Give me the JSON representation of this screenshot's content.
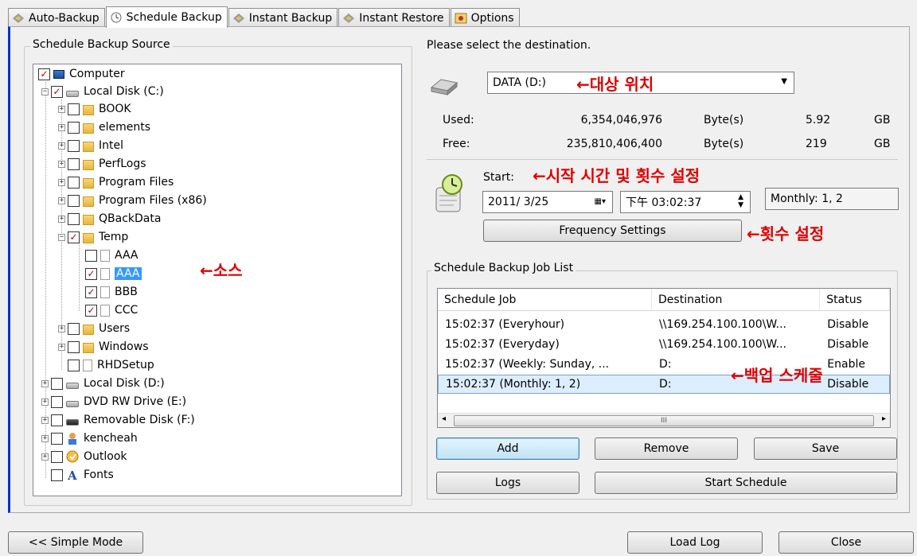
{
  "tabs": [
    {
      "label": "Auto-Backup"
    },
    {
      "label": "Schedule Backup"
    },
    {
      "label": "Instant Backup"
    },
    {
      "label": "Instant Restore"
    },
    {
      "label": "Options"
    }
  ],
  "source": {
    "group_label": "Schedule Backup Source",
    "tree": [
      {
        "label": "Computer"
      },
      {
        "label": "Local Disk (C:)"
      },
      {
        "label": "BOOK"
      },
      {
        "label": "elements"
      },
      {
        "label": "Intel"
      },
      {
        "label": "PerfLogs"
      },
      {
        "label": "Program Files"
      },
      {
        "label": "Program Files (x86)"
      },
      {
        "label": "QBackData"
      },
      {
        "label": "Temp"
      },
      {
        "label": "AAA"
      },
      {
        "label": "AAA"
      },
      {
        "label": "BBB"
      },
      {
        "label": "CCC"
      },
      {
        "label": "Users"
      },
      {
        "label": "Windows"
      },
      {
        "label": "RHDSetup"
      },
      {
        "label": "Local Disk (D:)"
      },
      {
        "label": "DVD RW Drive (E:)"
      },
      {
        "label": "Removable Disk (F:)"
      },
      {
        "label": "kencheah"
      },
      {
        "label": "Outlook"
      },
      {
        "label": "Fonts"
      }
    ]
  },
  "destination": {
    "prompt": "Please select the destination.",
    "selected": "DATA (D:)",
    "used_label": "Used:",
    "used_bytes": "6,354,046,976",
    "used_unit": "Byte(s)",
    "used_gb": "5.92",
    "free_label": "Free:",
    "free_bytes": "235,810,406,400",
    "free_unit": "Byte(s)",
    "free_gb": "219",
    "gb": "GB"
  },
  "schedule": {
    "start_label": "Start:",
    "date": "2011/ 3/25",
    "time": "下午 03:02:37",
    "summary": "Monthly: 1, 2",
    "frequency_button": "Frequency Settings"
  },
  "joblist": {
    "group_label": "Schedule Backup Job List",
    "columns": [
      "Schedule Job",
      "Destination",
      "Status"
    ],
    "rows": [
      {
        "job": "15:02:37 (Everyhour)",
        "dest": "\\\\169.254.100.100\\W...",
        "status": "Disable"
      },
      {
        "job": "15:02:37 (Everyday)",
        "dest": "\\\\169.254.100.100\\W...",
        "status": "Disable"
      },
      {
        "job": "15:02:37 (Weekly: Sunday, ...",
        "dest": "D:",
        "status": "Enable"
      },
      {
        "job": "15:02:37 (Monthly: 1, 2)",
        "dest": "D:",
        "status": "Disable"
      }
    ],
    "scroll_grip": "III"
  },
  "buttons": {
    "add": "Add",
    "remove": "Remove",
    "save": "Save",
    "logs": "Logs",
    "start_schedule": "Start Schedule",
    "simple_mode": "<< Simple Mode",
    "load_log": "Load Log",
    "close": "Close"
  },
  "annotations": {
    "destination": "←대상 위치",
    "start": "←시작 시간 및 횟수 설정",
    "frequency": "←횟수 설정",
    "source": "←소스",
    "schedule": "←백업 스케줄"
  },
  "colors": {
    "annotation": "#e00000",
    "selection": "#3399ff",
    "accent_border": "#0033cc"
  }
}
